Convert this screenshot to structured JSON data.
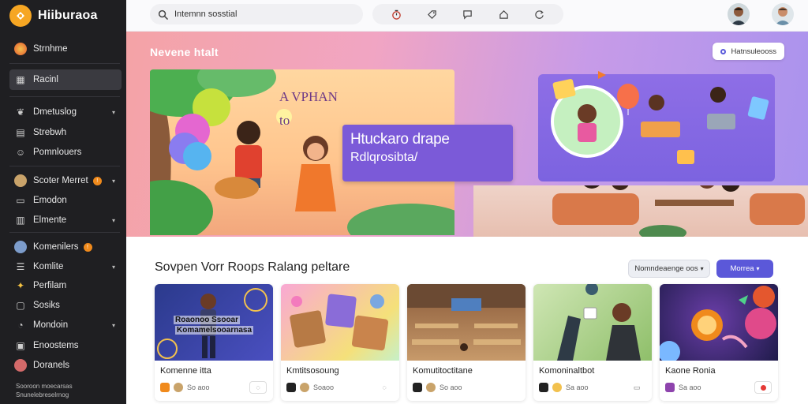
{
  "app": {
    "name": "Hiiburaoa"
  },
  "sidebar": {
    "items": [
      {
        "label": "Strnhme",
        "icon": "globe-icon"
      },
      {
        "label": "Racinl",
        "icon": "grid-icon",
        "active": true
      },
      {
        "label": "Dmetuslog",
        "icon": "leaf-icon",
        "chevron": true
      },
      {
        "label": "Strebwh",
        "icon": "document-icon"
      },
      {
        "label": "Pomnlouers",
        "icon": "people-icon"
      },
      {
        "label": "Scoter Merret",
        "icon": "camera-icon",
        "badge": "!",
        "chevron": true
      },
      {
        "label": "Emodon",
        "icon": "folder-icon"
      },
      {
        "label": "Elmente",
        "icon": "chart-icon",
        "chevron": true
      },
      {
        "label": "Komenilers",
        "icon": "chat-icon",
        "badge": "!"
      },
      {
        "label": "Komlite",
        "icon": "list-icon",
        "chevron": true
      },
      {
        "label": "Perfilam",
        "icon": "star-icon"
      },
      {
        "label": "Sosiks",
        "icon": "bookmark-icon"
      },
      {
        "label": "Mondoin",
        "icon": "bell-icon",
        "chevron": true
      },
      {
        "label": "Enoostems",
        "icon": "box-icon"
      },
      {
        "label": "Doranels",
        "icon": "avatar-icon"
      }
    ],
    "footer_line1": "Sooroon moecarsas",
    "footer_line2": "Snunelebreselrnog"
  },
  "topbar": {
    "search_value": "Intemnn sosstial",
    "tools": [
      "timer-icon",
      "tag-icon",
      "message-icon",
      "home-icon",
      "refresh-icon"
    ]
  },
  "hero": {
    "title": "Nevene htalt",
    "chip_label": "Hatnsuleooss",
    "small_line1": "A VPHAN",
    "small_line2": "to",
    "card_line1": "Htuckaro drape",
    "card_line2": "Rdlqrosibta/"
  },
  "section": {
    "title": "Sovpen Vorr Roops Ralang peltare",
    "filter_label": "Nomndeaenge oos",
    "primary_label": "Morrea"
  },
  "cards": [
    {
      "title": "Komenne itta",
      "meta": "So aoo",
      "thumb_text1": "Roaonoo Ssooar",
      "thumb_text2": "Komamelsooarnasa"
    },
    {
      "title": "Kmtitsosoung",
      "meta": "Soaoo",
      "thumb_text1": "",
      "thumb_text2": ""
    },
    {
      "title": "Komutitoctitane",
      "meta": "So aoo",
      "thumb_text1": "",
      "thumb_text2": ""
    },
    {
      "title": "Komoninaltbot",
      "meta": "Sa aoo",
      "thumb_text1": "",
      "thumb_text2": ""
    },
    {
      "title": "Kaone Ronia",
      "meta": "Sa aoo",
      "thumb_text1": "",
      "thumb_text2": ""
    }
  ],
  "colors": {
    "accent": "#5b58d9",
    "sidebar": "#1f1f22",
    "badge": "#f08a1c"
  }
}
